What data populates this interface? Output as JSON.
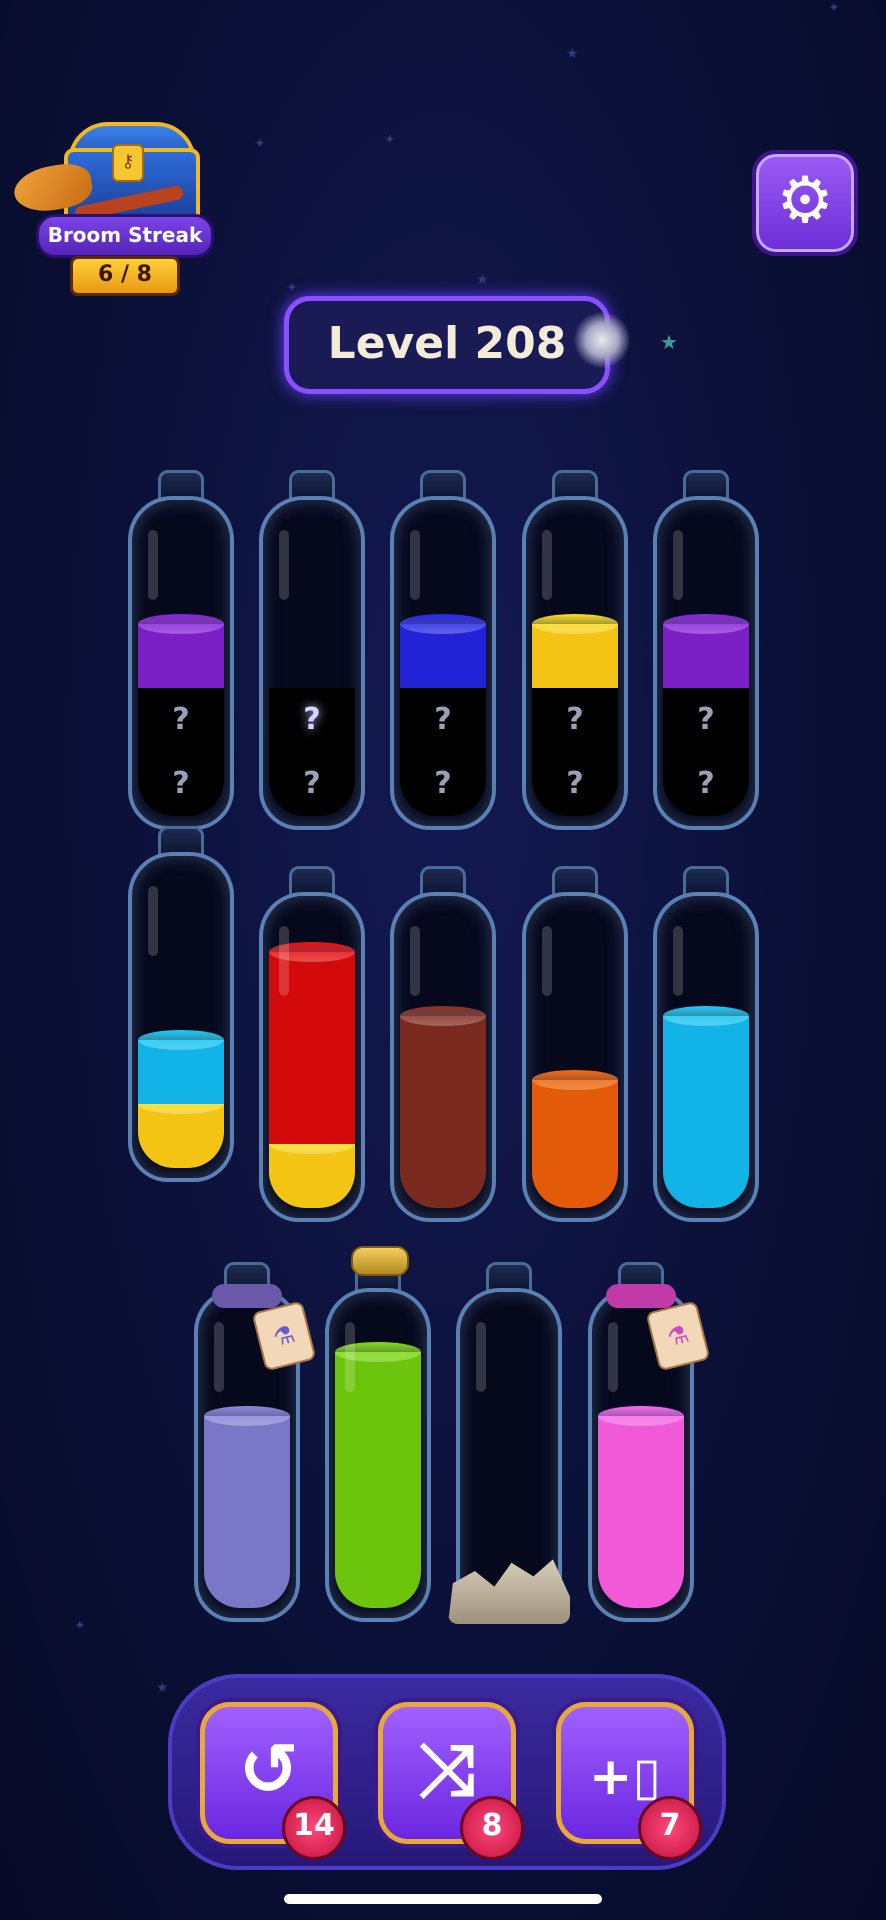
{
  "streak": {
    "title": "Broom Streak",
    "count": "6 / 8"
  },
  "level": {
    "label": "Level 208"
  },
  "unknown_mark": "?",
  "powerups": [
    {
      "name": "undo",
      "icon": "undo-icon",
      "count": "14"
    },
    {
      "name": "shuffle",
      "icon": "shuffle-icon",
      "count": "8"
    },
    {
      "name": "add-bottle",
      "icon": "add-bottle-icon",
      "count": "7"
    }
  ],
  "bottles": [
    {
      "row": 1,
      "layers_bottom_up": [
        "hidden",
        "hidden",
        "purple"
      ],
      "colors": [
        "#000000",
        "#000000",
        "#7b1fc6"
      ]
    },
    {
      "row": 1,
      "layers_bottom_up": [
        "hidden",
        "hidden-swirl"
      ],
      "colors": [
        "#000000",
        "#000000"
      ]
    },
    {
      "row": 1,
      "layers_bottom_up": [
        "hidden",
        "hidden",
        "blue"
      ],
      "colors": [
        "#000000",
        "#000000",
        "#2222d6"
      ]
    },
    {
      "row": 1,
      "layers_bottom_up": [
        "hidden",
        "hidden",
        "yellow"
      ],
      "colors": [
        "#000000",
        "#000000",
        "#f4c414"
      ]
    },
    {
      "row": 1,
      "layers_bottom_up": [
        "hidden",
        "hidden",
        "purple"
      ],
      "colors": [
        "#000000",
        "#000000",
        "#7b1fc6"
      ]
    },
    {
      "row": 2,
      "layers_bottom_up": [
        "yellow",
        "cyan"
      ],
      "colors": [
        "#f4c414",
        "#12b4e8"
      ]
    },
    {
      "row": 2,
      "layers_bottom_up": [
        "yellow",
        "red",
        "red",
        "red"
      ],
      "colors": [
        "#f4c414",
        "#d40a0a"
      ]
    },
    {
      "row": 2,
      "layers_bottom_up": [
        "brown",
        "brown",
        "brown"
      ],
      "colors": [
        "#7a2a1e"
      ]
    },
    {
      "row": 2,
      "layers_bottom_up": [
        "orange",
        "orange"
      ],
      "colors": [
        "#e35a08"
      ]
    },
    {
      "row": 2,
      "layers_bottom_up": [
        "cyan",
        "cyan",
        "cyan"
      ],
      "colors": [
        "#12a9dc"
      ]
    },
    {
      "row": 3,
      "layers_bottom_up": [
        "lavender",
        "lavender",
        "lavender"
      ],
      "colors": [
        "#7a76c8"
      ],
      "locked": "rope-tag"
    },
    {
      "row": 3,
      "layers_bottom_up": [
        "green",
        "green",
        "green",
        "green"
      ],
      "colors": [
        "#6cc40c"
      ],
      "corked": true
    },
    {
      "row": 3,
      "layers_bottom_up": [],
      "colors": [],
      "blocked": "rocks"
    },
    {
      "row": 3,
      "layers_bottom_up": [
        "pink",
        "pink",
        "pink"
      ],
      "colors": [
        "#f05ad8"
      ],
      "locked": "rope-tag"
    }
  ]
}
